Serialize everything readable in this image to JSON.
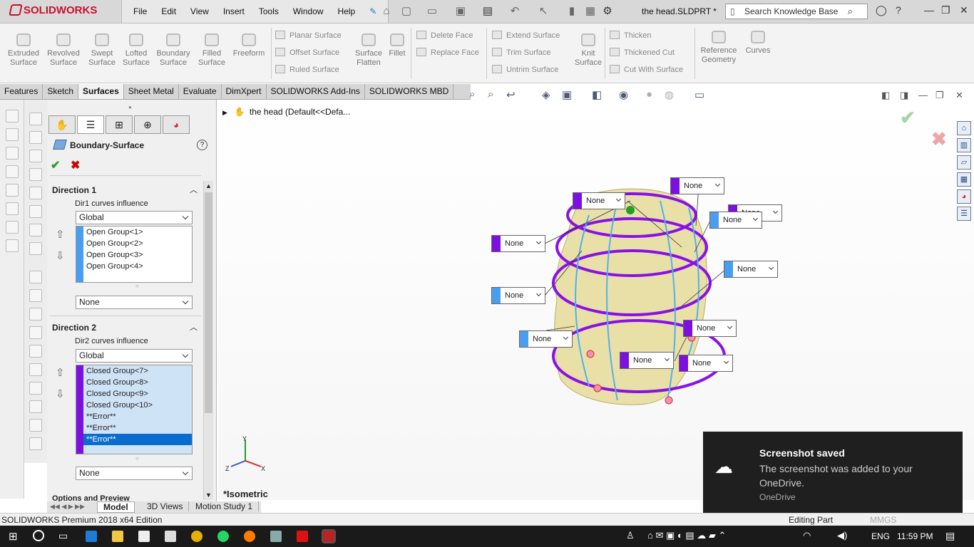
{
  "app": {
    "brand": "SOLIDWORKS",
    "doc_title": "the head.SLDPRT *",
    "search_placeholder": "Search Knowledge Base"
  },
  "menu": [
    "File",
    "Edit",
    "View",
    "Insert",
    "Tools",
    "Window",
    "Help"
  ],
  "ribbon": {
    "big": [
      {
        "label": "Extruded Surface"
      },
      {
        "label": "Revolved Surface"
      },
      {
        "label": "Swept Surface"
      },
      {
        "label": "Lofted Surface"
      },
      {
        "label": "Boundary Surface"
      },
      {
        "label": "Filled Surface"
      },
      {
        "label": "Freeform"
      }
    ],
    "col1": [
      "Planar Surface",
      "Offset Surface",
      "Ruled Surface"
    ],
    "flatten": "Surface Flatten",
    "fillet": "Fillet",
    "col2": [
      "Delete Face",
      "Replace Face"
    ],
    "col3": [
      "Extend Surface",
      "Trim Surface",
      "Untrim Surface"
    ],
    "knit": "Knit Surface",
    "col4": [
      "Thicken",
      "Thickened Cut",
      "Cut With Surface"
    ],
    "refgeo": "Reference Geometry",
    "curves": "Curves"
  },
  "tabs": [
    "Features",
    "Sketch",
    "Surfaces",
    "Sheet Metal",
    "Evaluate",
    "DimXpert",
    "SOLIDWORKS Add-Ins",
    "SOLIDWORKS MBD"
  ],
  "active_tab": "Surfaces",
  "tree": {
    "root": "the head  (Default<<Defa..."
  },
  "pm": {
    "title": "Boundary-Surface",
    "dir1": {
      "title": "Direction 1",
      "influence_label": "Dir1 curves influence",
      "influence": "Global",
      "items": [
        "Open Group<1>",
        "Open Group<2>",
        "Open Group<3>",
        "Open Group<4>"
      ],
      "tangency": "None",
      "color": "#4a9ef0"
    },
    "dir2": {
      "title": "Direction 2",
      "influence_label": "Dir2 curves influence",
      "influence": "Global",
      "items": [
        "Closed Group<7>",
        "Closed Group<8>",
        "Closed Group<9>",
        "Closed Group<10>",
        "**Error**",
        "**Error**",
        "**Error**"
      ],
      "tangency": "None",
      "color": "#7b10e0"
    },
    "options": "Options and Preview"
  },
  "callouts": [
    {
      "label": "None",
      "kind": "dir2"
    },
    {
      "label": "None",
      "kind": "dir2"
    },
    {
      "label": "None",
      "kind": "dir2"
    },
    {
      "label": "None",
      "kind": "dir1"
    },
    {
      "label": "None",
      "kind": "dir2"
    },
    {
      "label": "None",
      "kind": "dir1"
    },
    {
      "label": "None",
      "kind": "dir1"
    },
    {
      "label": "None",
      "kind": "dir1"
    },
    {
      "label": "None",
      "kind": "dir2"
    },
    {
      "label": "None",
      "kind": "dir2"
    },
    {
      "label": "None",
      "kind": "dir2"
    },
    {
      "label": "None",
      "kind": "dir1"
    }
  ],
  "view_label": "*Isometric",
  "bottom_tabs": [
    "Model",
    "3D Views",
    "Motion Study 1"
  ],
  "status": {
    "left": "SOLIDWORKS Premium 2018 x64 Edition",
    "mode": "Editing Part",
    "units": "MMGS"
  },
  "toast": {
    "title": "Screenshot saved",
    "body": "The screenshot was added to your OneDrive.",
    "source": "OneDrive"
  },
  "taskbar": {
    "lang": "ENG",
    "time": "11:59 PM"
  }
}
